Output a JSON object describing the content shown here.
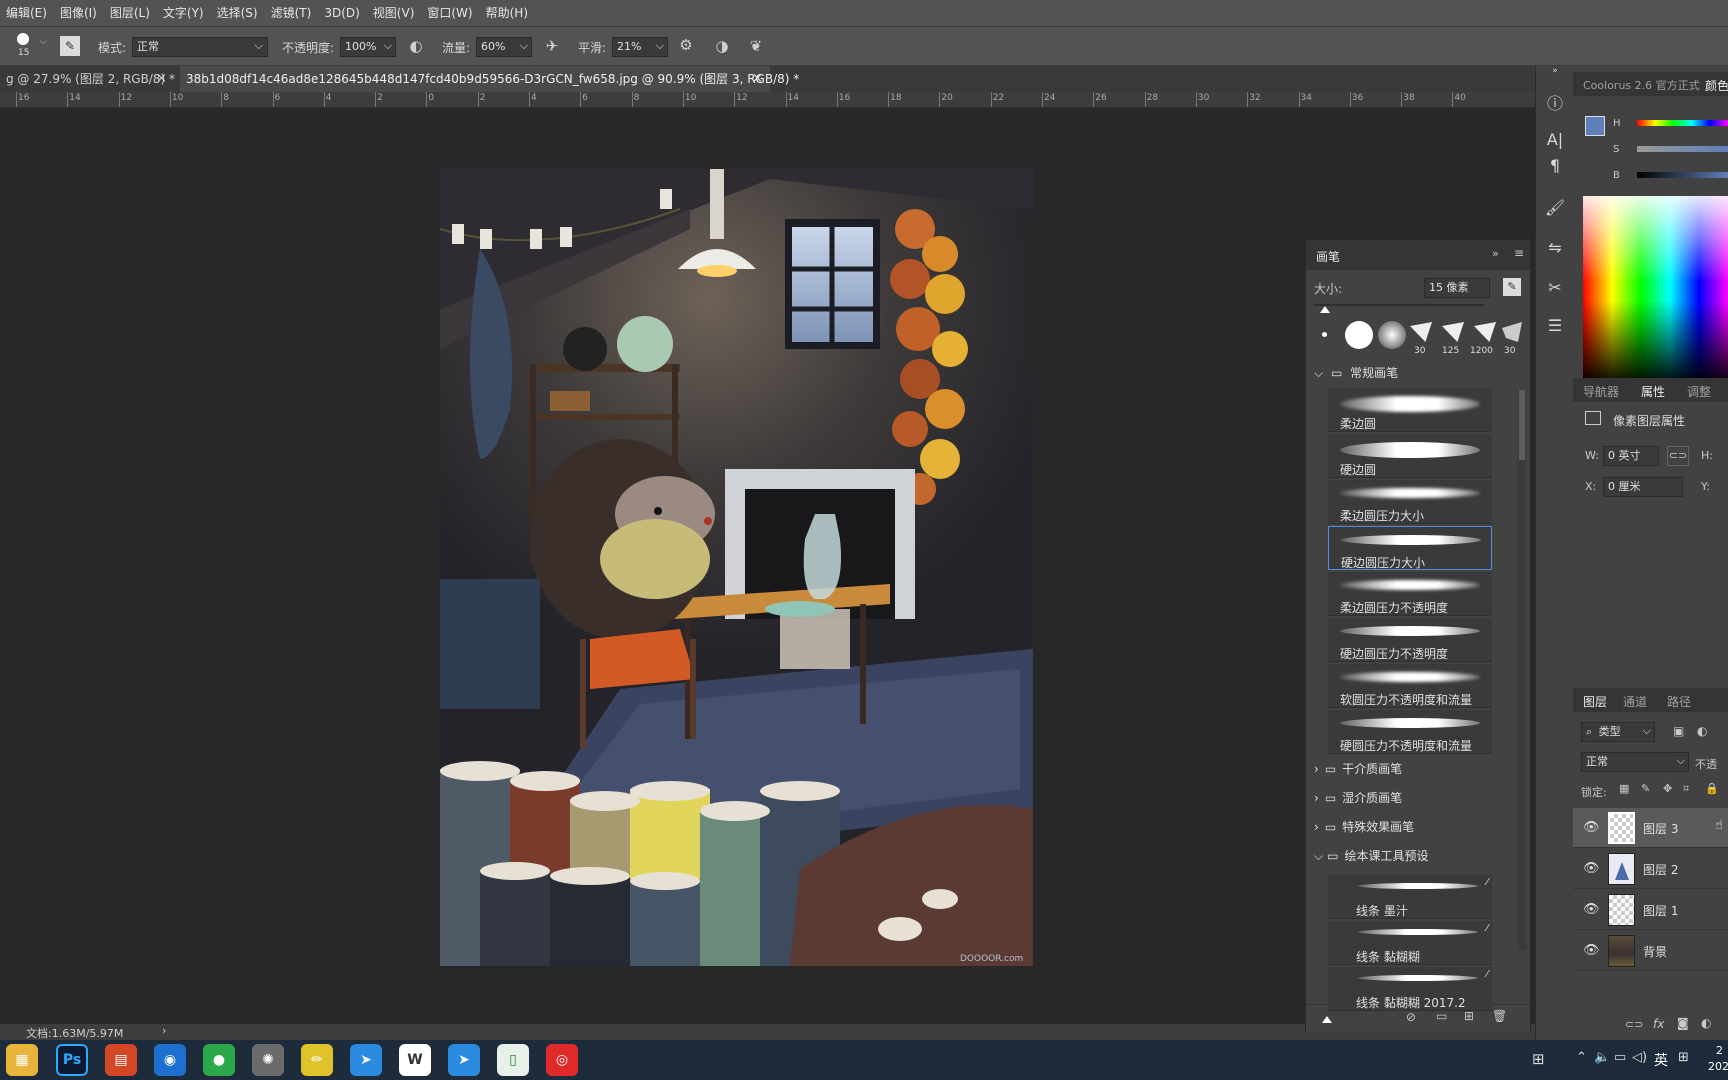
{
  "menubar": {
    "items": [
      "编辑(E)",
      "图像(I)",
      "图层(L)",
      "文字(Y)",
      "选择(S)",
      "滤镜(T)",
      "3D(D)",
      "视图(V)",
      "窗口(W)",
      "帮助(H)"
    ]
  },
  "options": {
    "brush_size": "15",
    "mode_label": "模式:",
    "mode_value": "正常",
    "opacity_label": "不透明度:",
    "opacity_value": "100%",
    "flow_label": "流量:",
    "flow_value": "60%",
    "smooth_label": "平滑:",
    "smooth_value": "21%"
  },
  "tabs": [
    {
      "label": "g @ 27.9% (图层 2, RGB/8) *",
      "close": "×"
    },
    {
      "label": "38b1d08df14c46ad8e128645b448d147fcd40b9d59566-D3rGCN_fw658.jpg @ 90.9% (图层 3, RGB/8) *",
      "close": "×"
    }
  ],
  "ruler": {
    "labels": [
      "16",
      "14",
      "12",
      "10",
      "8",
      "6",
      "4",
      "2",
      "0",
      "2",
      "4",
      "6",
      "8",
      "10",
      "12",
      "14",
      "16",
      "18",
      "20",
      "22",
      "24",
      "26",
      "28",
      "30",
      "32",
      "34",
      "36",
      "38",
      "40"
    ]
  },
  "artwork": {
    "watermark": "DOOOOR.com"
  },
  "status": {
    "doc": "文档:1.63M/5.97M",
    "arrow": "›"
  },
  "brush_panel": {
    "title": "画笔",
    "size_label": "大小:",
    "size_value": "15 像素",
    "tip_numbers": [
      "30",
      "125",
      "1200",
      "30"
    ],
    "group_general": "常规画笔",
    "brushes": [
      "柔边圆",
      "硬边圆",
      "柔边圆压力大小",
      "硬边圆压力大小",
      "柔边圆压力不透明度",
      "硬边圆压力不透明度",
      "软圆压力不透明度和流量",
      "硬圆压力不透明度和流量"
    ],
    "selected_index": 3,
    "folders": [
      "干介质画笔",
      "湿介质画笔",
      "特殊效果画笔",
      "绘本课工具预设"
    ],
    "sub_brushes": [
      "线条 墨汁",
      "线条 黏糊糊",
      "线条 黏糊糊 2017.2"
    ]
  },
  "right_panel": {
    "coolorus_tab": "Coolorus 2.6 官方正式",
    "color_tab": "颜色",
    "hsb": [
      "H",
      "S",
      "B"
    ],
    "props_tabs": [
      "导航器",
      "属性",
      "调整"
    ],
    "props_title": "像素图层属性",
    "w_label": "W:",
    "w_value": "0 英寸",
    "h_label": "H:",
    "x_label": "X:",
    "x_value": "0 厘米",
    "y_label": "Y:",
    "layers_tabs": [
      "图层",
      "通道",
      "路径"
    ],
    "filter_label": "类型",
    "blend_mode": "正常",
    "opacity_short": "不透",
    "lock_label": "锁定:",
    "layers": [
      "图层 3",
      "图层 2",
      "图层 1",
      "背景"
    ],
    "footer_icons": [
      "fx"
    ]
  },
  "taskbar": {
    "ps_label": "Ps",
    "ime_label": "英",
    "clock_top": "2",
    "clock_bottom": "202"
  },
  "colors": {
    "accent_blue": "#4b8ee8",
    "fg_swatch": "#5f7fb8"
  }
}
